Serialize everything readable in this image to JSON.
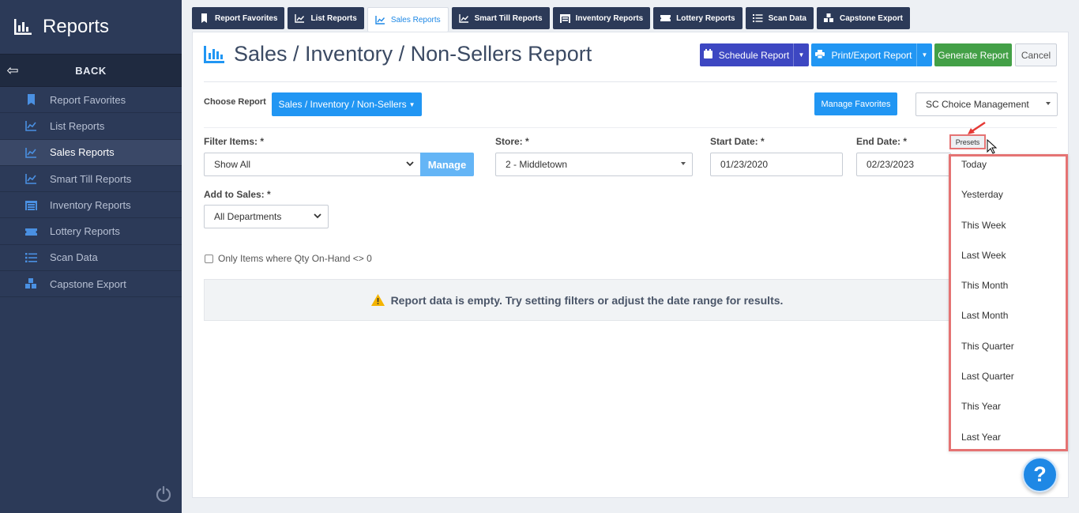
{
  "app": {
    "title": "Reports",
    "back_label": "BACK"
  },
  "sidebar": {
    "items": [
      {
        "label": "Report Favorites",
        "icon": "bookmark-icon"
      },
      {
        "label": "List Reports",
        "icon": "chart-line-icon"
      },
      {
        "label": "Sales Reports",
        "icon": "chart-line-icon",
        "active": true
      },
      {
        "label": "Smart Till Reports",
        "icon": "chart-line-icon"
      },
      {
        "label": "Inventory Reports",
        "icon": "warehouse-icon"
      },
      {
        "label": "Lottery Reports",
        "icon": "ticket-icon"
      },
      {
        "label": "Scan Data",
        "icon": "list-icon"
      },
      {
        "label": "Capstone Export",
        "icon": "cubes-icon"
      }
    ]
  },
  "tabs": [
    {
      "label": "Report Favorites"
    },
    {
      "label": "List Reports"
    },
    {
      "label": "Sales Reports",
      "active": true
    },
    {
      "label": "Smart Till Reports"
    },
    {
      "label": "Inventory Reports"
    },
    {
      "label": "Lottery Reports"
    },
    {
      "label": "Scan Data"
    },
    {
      "label": "Capstone Export"
    }
  ],
  "header": {
    "title": "Sales / Inventory / Non-Sellers Report",
    "schedule_label": "Schedule Report",
    "print_label": "Print/Export Report",
    "generate_label": "Generate Report",
    "cancel_label": "Cancel"
  },
  "choose": {
    "label": "Choose Report",
    "value": "Sales / Inventory / Non-Sellers",
    "manage_favorites_label": "Manage Favorites",
    "management_value": "SC Choice Management"
  },
  "filters": {
    "filter_items_label": "Filter Items: *",
    "filter_items_value": "Show All",
    "manage_label": "Manage",
    "store_label": "Store: *",
    "store_value": "2 - Middletown",
    "start_date_label": "Start Date: *",
    "start_date_value": "01/23/2020",
    "end_date_label": "End Date: *",
    "end_date_value": "02/23/2023",
    "add_to_sales_label": "Add to Sales: *",
    "add_to_sales_value": "All Departments",
    "checkbox_label": "Only Items where Qty On-Hand <> 0"
  },
  "empty_message": "Report data is empty. Try setting filters or adjust the date range for results.",
  "presets": {
    "button_label": "Presets",
    "items": [
      "Today",
      "Yesterday",
      "This Week",
      "Last Week",
      "This Month",
      "Last Month",
      "This Quarter",
      "Last Quarter",
      "This Year",
      "Last Year"
    ]
  },
  "help_label": "?",
  "colors": {
    "sidebar": "#2c3a58",
    "primary": "#2196f3",
    "indigo": "#3d47c2",
    "success": "#43a047",
    "highlight": "#e57373"
  }
}
